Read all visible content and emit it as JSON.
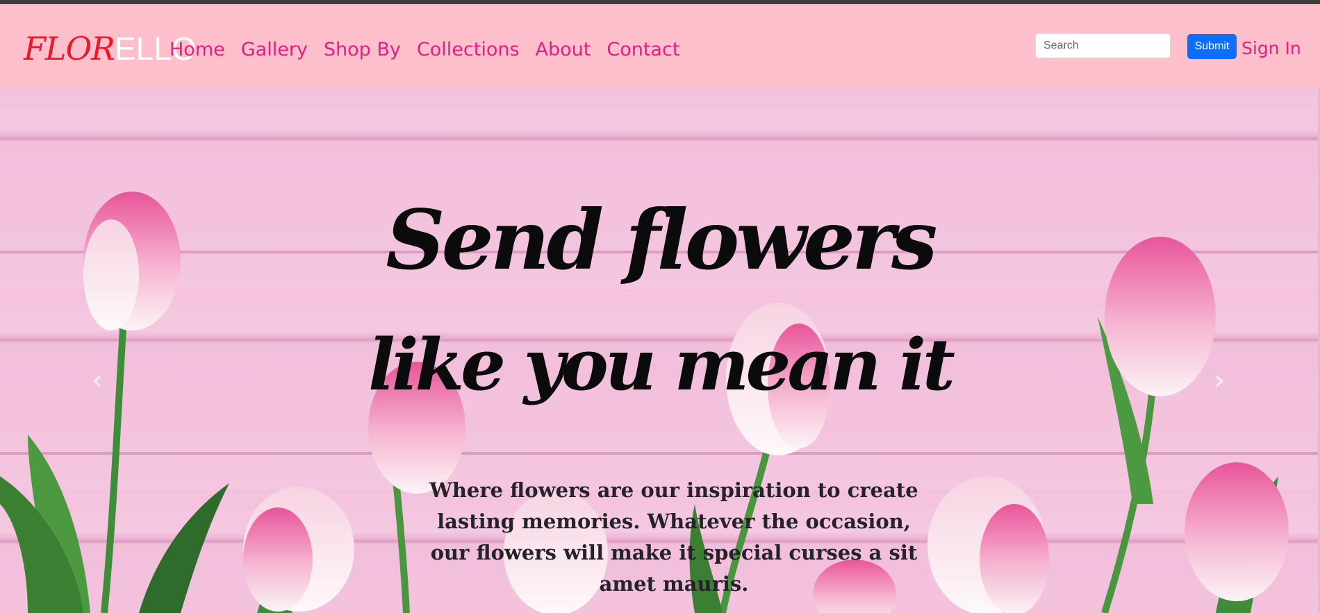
{
  "brand": {
    "part1": "FLOR",
    "part2": "ELLO"
  },
  "nav": {
    "items": [
      {
        "label": "Home"
      },
      {
        "label": "Gallery"
      },
      {
        "label": "Shop By"
      },
      {
        "label": "Collections"
      },
      {
        "label": "About"
      },
      {
        "label": "Contact"
      }
    ]
  },
  "search": {
    "placeholder": "Search",
    "value": ""
  },
  "submit_label": "Submit",
  "signin_label": "Sign In",
  "hero": {
    "title_line1": "Send flowers",
    "title_line2": "like you mean it",
    "text": "Where flowers are our inspiration to create lasting memories. Whatever the occasion, our flowers will make it special curses a sit amet mauris."
  },
  "carousel": {
    "prev_glyph": "‹",
    "next_glyph": "›"
  },
  "colors": {
    "navbar_bg": "#fdbfca",
    "nav_link": "#e51d87",
    "brand_red": "#f0162a",
    "submit_bg": "#0d6efd"
  },
  "icons": {
    "prev": "chevron-left-icon",
    "next": "chevron-right-icon"
  }
}
